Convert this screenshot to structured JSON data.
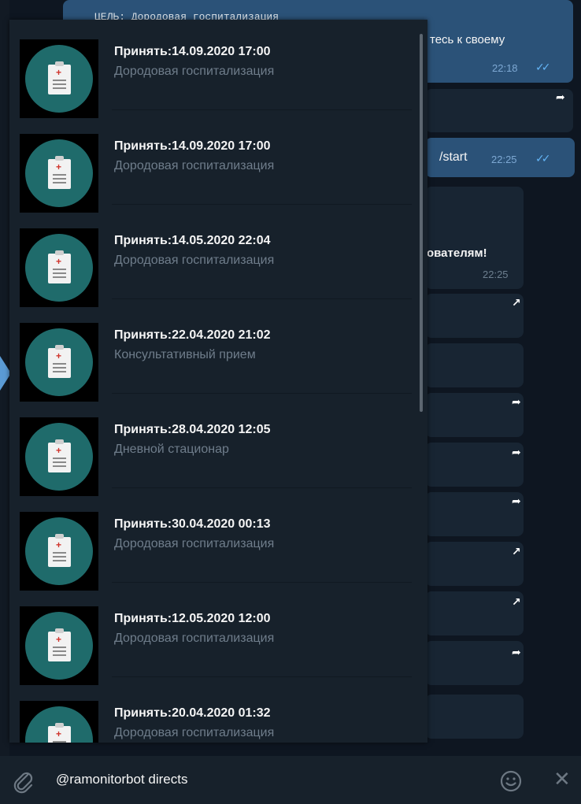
{
  "background_chat": {
    "top_partial_text": "ЦЕЛЬ: Дородовая госпитализация",
    "bubble1_text": "тесь к своему",
    "bubble1_time": "22:18",
    "bubble2_text": "/start",
    "bubble2_time": "22:25",
    "bubble3_text": "ователям!",
    "bubble3_time": "22:25"
  },
  "popup": {
    "items": [
      {
        "title": "Принять:14.09.2020 17:00",
        "subtitle": "Дородовая госпитализация"
      },
      {
        "title": "Принять:14.09.2020 17:00",
        "subtitle": "Дородовая госпитализация"
      },
      {
        "title": "Принять:14.05.2020 22:04",
        "subtitle": "Дородовая госпитализация"
      },
      {
        "title": "Принять:22.04.2020 21:02",
        "subtitle": "Консультативный прием"
      },
      {
        "title": "Принять:28.04.2020 12:05",
        "subtitle": "Дневной стационар"
      },
      {
        "title": "Принять:30.04.2020 00:13",
        "subtitle": "Дородовая госпитализация"
      },
      {
        "title": "Принять:12.05.2020 12:00",
        "subtitle": "Дородовая госпитализация"
      },
      {
        "title": "Принять:20.04.2020 01:32",
        "subtitle": "Дородовая госпитализация"
      }
    ]
  },
  "input": {
    "value": "@ramonitorbot directs"
  },
  "icons": {
    "attach": "paperclip-icon",
    "emoji": "smile-icon",
    "close": "close-icon",
    "thumbnail": "clipboard-icon"
  },
  "colors": {
    "chat_bg": "#0e1621",
    "panel_bg": "#17212b",
    "out_bubble": "#2b5278",
    "thumb_circle": "#1f6b6b",
    "subtitle": "#6f7d8b"
  }
}
